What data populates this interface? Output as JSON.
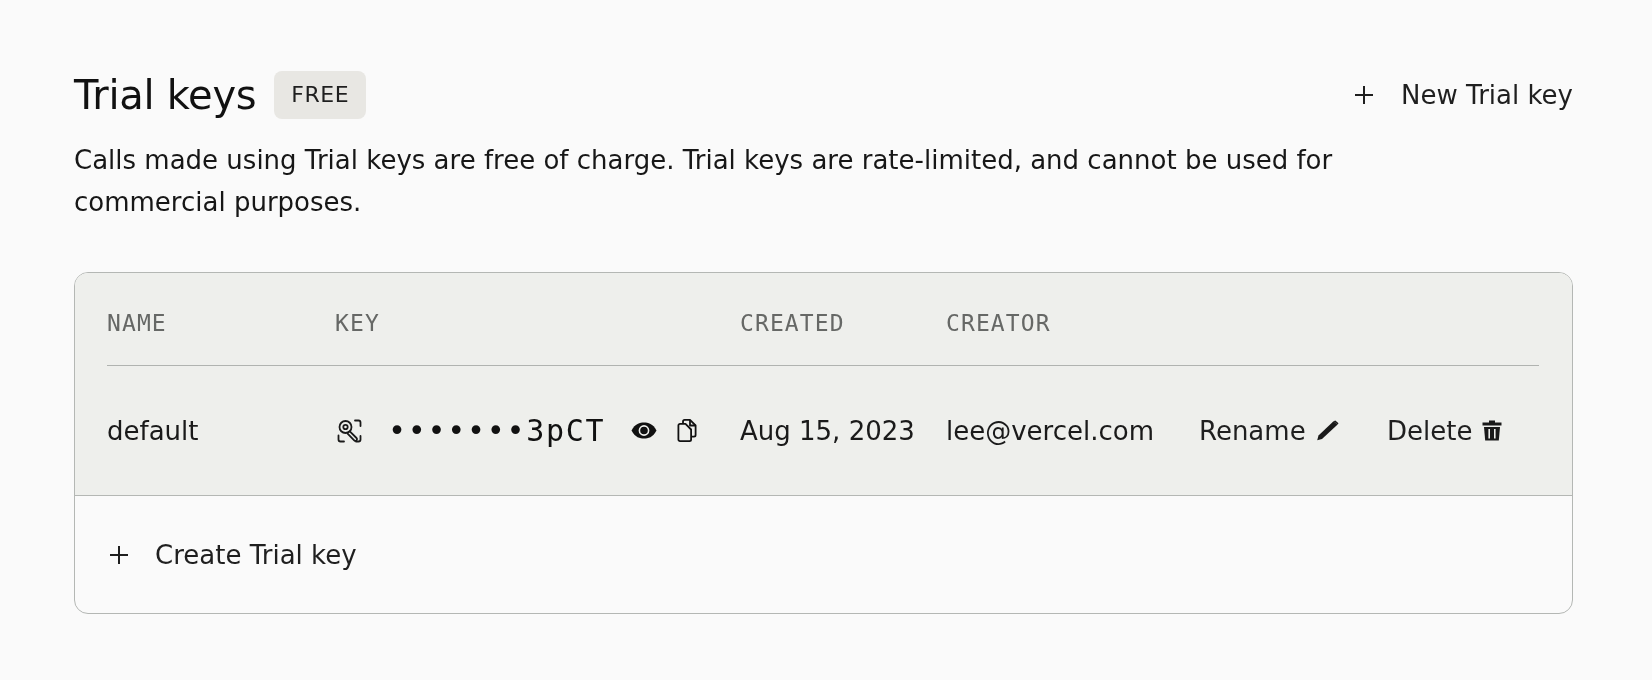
{
  "header": {
    "title": "Trial keys",
    "badge": "FREE",
    "new_button": "New Trial key"
  },
  "description": "Calls made using Trial keys are free of charge. Trial keys are rate-limited, and cannot be used for commercial purposes.",
  "table": {
    "columns": [
      "NAME",
      "KEY",
      "CREATED",
      "CREATOR"
    ],
    "rows": [
      {
        "name": "default",
        "key": "•••••••3pCT",
        "created": "Aug 15, 2023",
        "creator": "lee@vercel.com",
        "actions": [
          {
            "kind": "rename",
            "label": "Rename"
          },
          {
            "kind": "delete",
            "label": "Delete"
          }
        ]
      }
    ]
  },
  "create_button": "Create Trial key"
}
